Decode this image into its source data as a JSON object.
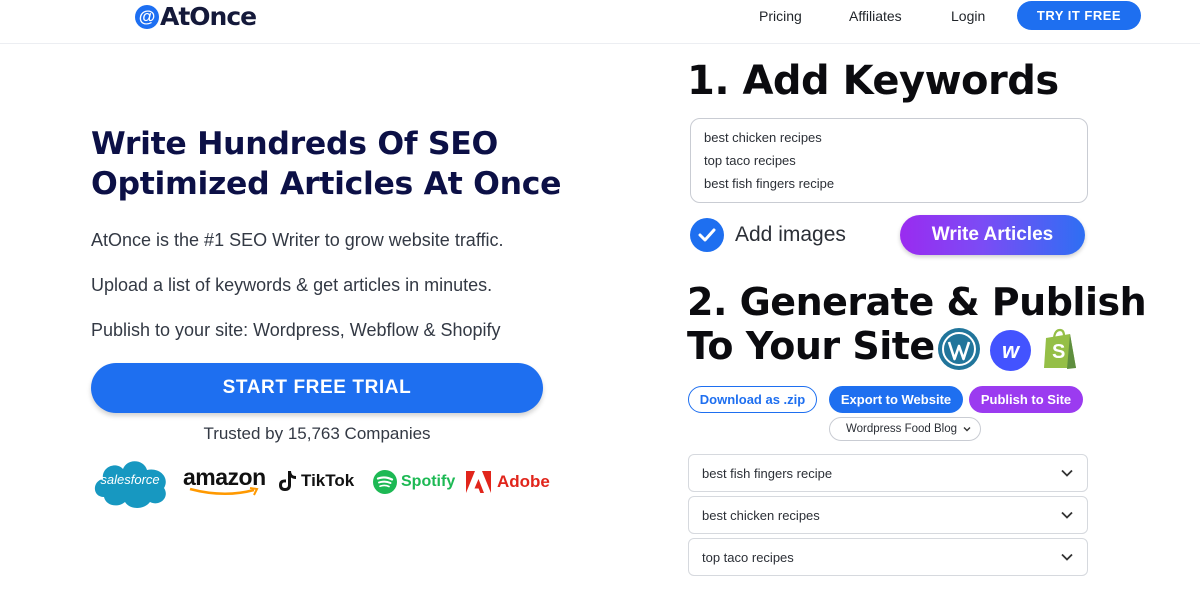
{
  "header": {
    "logo_text": "AtOnce",
    "logo_mark": "@",
    "nav": [
      "Pricing",
      "Affiliates",
      "Login"
    ],
    "cta": "TRY IT FREE"
  },
  "hero": {
    "title_line1": "Write Hundreds Of SEO",
    "title_line2": "Optimized Articles At Once",
    "line1": "AtOnce is the #1 SEO Writer to grow website traffic.",
    "line2": "Upload a list of keywords & get articles in minutes.",
    "line3": "Publish to your site: Wordpress, Webflow & Shopify",
    "cta": "START FREE TRIAL",
    "trusted": "Trusted by 15,763 Companies"
  },
  "brands": {
    "salesforce": "salesforce",
    "amazon": "amazon",
    "tiktok": "TikTok",
    "spotify": "Spotify",
    "adobe": "Adobe"
  },
  "step1": {
    "heading": "1. Add Keywords",
    "keywords": [
      "best chicken recipes",
      "top taco recipes",
      "best fish fingers recipe"
    ],
    "add_images_label": "Add images",
    "add_images_checked": true,
    "write_button": "Write Articles"
  },
  "step2": {
    "heading_line1": "2. Generate & Publish",
    "heading_line2": "To Your Site",
    "cms_icons": [
      "wordpress-icon",
      "webflow-icon",
      "shopify-icon"
    ],
    "webflow_letter": "w",
    "shopify_letter": "S",
    "download_button": "Download as .zip",
    "export_button": "Export to Website",
    "publish_button": "Publish to Site",
    "site_select": "Wordpress Food Blog",
    "articles": [
      "best fish fingers recipe",
      "best chicken recipes",
      "top taco recipes"
    ]
  },
  "colors": {
    "primary_blue": "#1e6ff0",
    "title_navy": "#0c1046",
    "publish_purple": "#9b3bf0",
    "spotify_green": "#1db954",
    "adobe_red": "#e1251b",
    "wordpress_blue": "#21759b",
    "webflow_blue": "#4353ff",
    "shopify_green": "#95bf47"
  }
}
